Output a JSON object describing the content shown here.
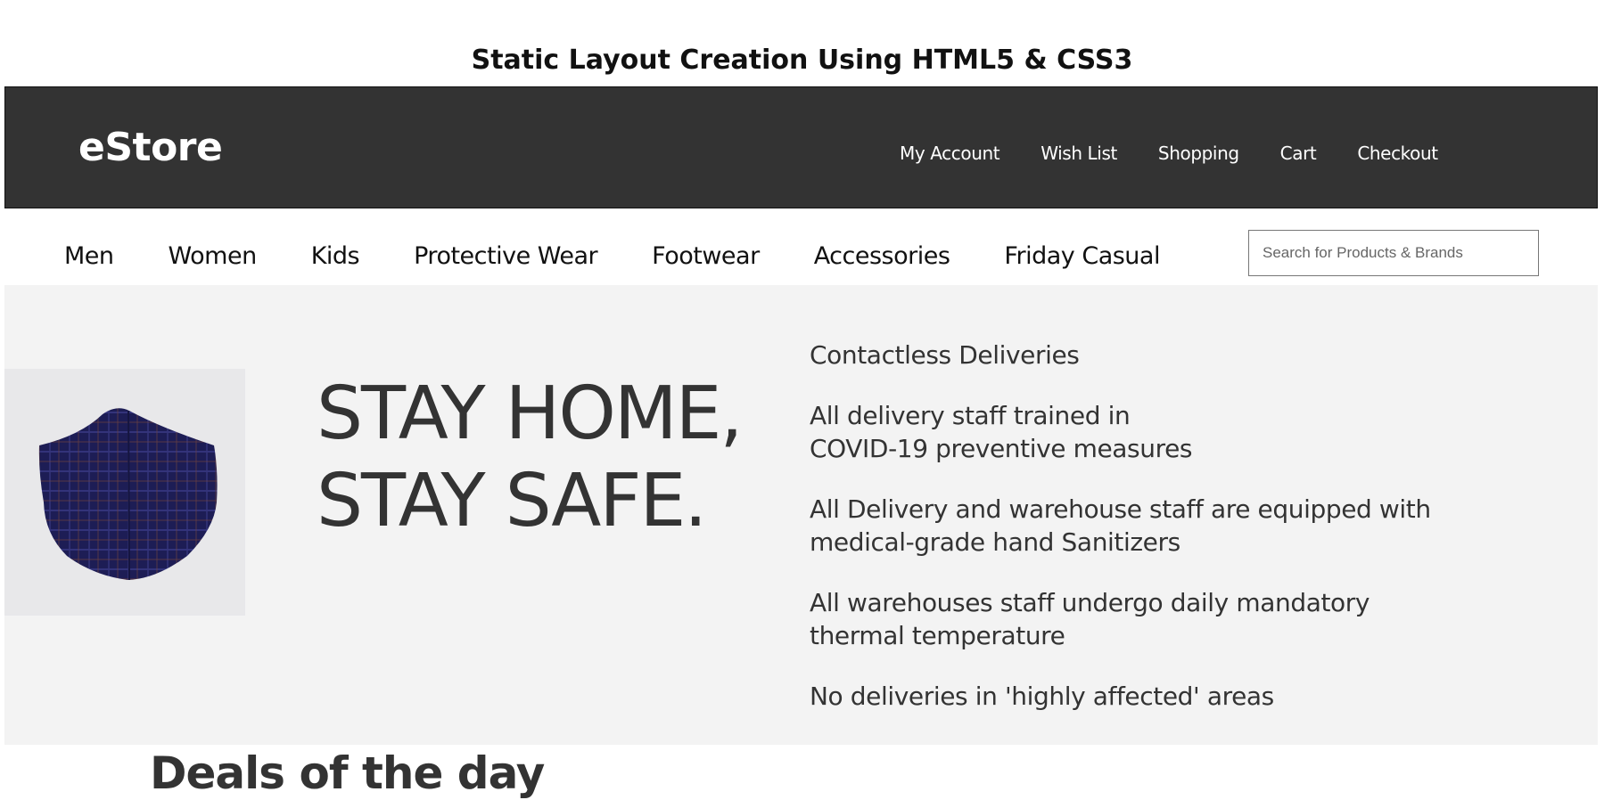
{
  "page_heading": "Static Layout Creation Using HTML5 & CSS3",
  "header": {
    "logo": "eStore",
    "account_nav": [
      "My Account",
      "Wish List",
      "Shopping",
      "Cart",
      "Checkout"
    ]
  },
  "categories": [
    "Men",
    "Women",
    "Kids",
    "Protective Wear",
    "Footwear",
    "Accessories",
    "Friday Casual"
  ],
  "search": {
    "placeholder": "Search for Products & Brands"
  },
  "hero": {
    "slogan_line1": "STAY HOME,",
    "slogan_line2": "STAY SAFE.",
    "notices": [
      "Contactless Deliveries",
      "All delivery staff trained in\nCOVID-19 preventive measures",
      "All Delivery and warehouse staff are equipped with\nmedical-grade hand Sanitizers",
      "All warehouses staff undergo daily mandatory\nthermal temperature",
      "No deliveries in 'highly affected' areas"
    ]
  },
  "deals": {
    "title": "Deals of the day"
  }
}
